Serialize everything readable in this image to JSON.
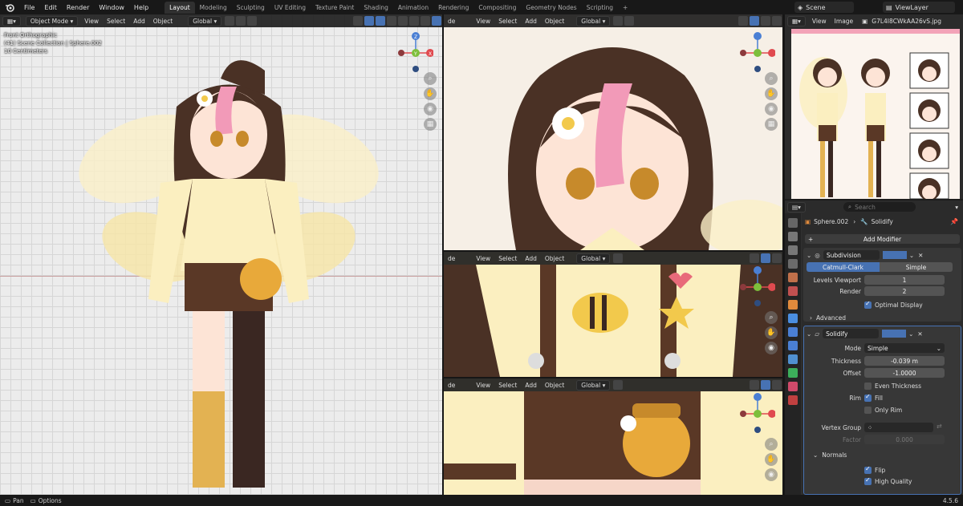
{
  "menu": [
    "File",
    "Edit",
    "Render",
    "Window",
    "Help"
  ],
  "workspaces": [
    "Layout",
    "Modeling",
    "Sculpting",
    "UV Editing",
    "Texture Paint",
    "Shading",
    "Animation",
    "Rendering",
    "Compositing",
    "Geometry Nodes",
    "Scripting",
    "+"
  ],
  "active_workspace": "Layout",
  "scene": "Scene",
  "view_layer": "ViewLayer",
  "viewport_main": {
    "mode": "Object Mode",
    "menus": [
      "View",
      "Select",
      "Add",
      "Object"
    ],
    "orientation": "Global",
    "overlay_lines": [
      "Front Orthographic",
      "(41) Scene Collection | Sphere.002",
      "10 Centimeters"
    ]
  },
  "viewport_side": {
    "mode_fragment": "de",
    "menus": [
      "View",
      "Select",
      "Add",
      "Object"
    ],
    "orientation": "Global"
  },
  "gizmo": {
    "x": "X",
    "y": "Y",
    "z": "Z"
  },
  "image_editor": {
    "menus": [
      "View",
      "Image"
    ],
    "filename": "G7L4I8CWkAA26vS.jpg"
  },
  "properties": {
    "search_placeholder": "Search",
    "breadcrumb_object": "Sphere.002",
    "breadcrumb_modifier": "Solidify",
    "add_modifier": "Add Modifier",
    "subdivision": {
      "name": "Subdivision",
      "types": [
        "Catmull-Clark",
        "Simple"
      ],
      "levels_viewport_label": "Levels Viewport",
      "levels_viewport": "1",
      "render_label": "Render",
      "render": "2",
      "optimal_display": "Optimal Display",
      "advanced": "Advanced"
    },
    "solidify": {
      "name": "Solidify",
      "mode_label": "Mode",
      "mode": "Simple",
      "thickness_label": "Thickness",
      "thickness": "-0.039 m",
      "offset_label": "Offset",
      "offset": "-1.0000",
      "even_thickness": "Even Thickness",
      "rim_label": "Rim",
      "fill": "Fill",
      "only_rim": "Only Rim",
      "vertex_group_label": "Vertex Group",
      "factor_label": "Factor",
      "factor": "0.000",
      "normals": "Normals",
      "flip": "Flip",
      "high_quality": "High Quality"
    }
  },
  "status": {
    "pan": "Pan",
    "options": "Options",
    "version": "4.5.6"
  },
  "colors": {
    "accent": "#4772b3",
    "x_axis": "#e04a4f",
    "y_axis": "#7dbf3b",
    "z_axis": "#4a7fd4",
    "active_tab": "#303030"
  }
}
